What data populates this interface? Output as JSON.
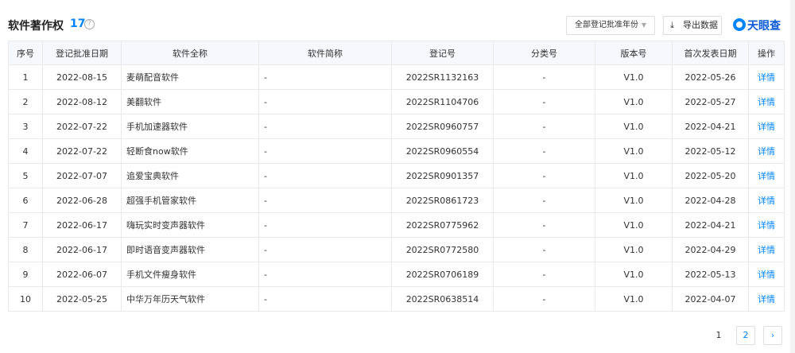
{
  "header": {
    "title": "软件著作权",
    "count": "17",
    "help_icon": "?",
    "year_select": "全部登记批准年份",
    "export_label": "导出数据",
    "logo_text": "天眼查"
  },
  "table": {
    "columns": [
      "序号",
      "登记批准日期",
      "软件全称",
      "软件简称",
      "登记号",
      "分类号",
      "版本号",
      "首次发表日期",
      "操作"
    ],
    "rows": [
      {
        "no": "1",
        "date": "2022-08-15",
        "name": "麦萌配音软件",
        "short": "-",
        "reg": "2022SR1132163",
        "cls": "-",
        "ver": "V1.0",
        "pub": "2022-05-26",
        "op": "详情"
      },
      {
        "no": "2",
        "date": "2022-08-12",
        "name": "美翻软件",
        "short": "-",
        "reg": "2022SR1104706",
        "cls": "-",
        "ver": "V1.0",
        "pub": "2022-05-27",
        "op": "详情"
      },
      {
        "no": "3",
        "date": "2022-07-22",
        "name": "手机加速器软件",
        "short": "-",
        "reg": "2022SR0960757",
        "cls": "-",
        "ver": "V1.0",
        "pub": "2022-04-21",
        "op": "详情"
      },
      {
        "no": "4",
        "date": "2022-07-22",
        "name": "轻断食now软件",
        "short": "-",
        "reg": "2022SR0960554",
        "cls": "-",
        "ver": "V1.0",
        "pub": "2022-05-12",
        "op": "详情"
      },
      {
        "no": "5",
        "date": "2022-07-07",
        "name": "追爱宝典软件",
        "short": "-",
        "reg": "2022SR0901357",
        "cls": "-",
        "ver": "V1.0",
        "pub": "2022-05-20",
        "op": "详情"
      },
      {
        "no": "6",
        "date": "2022-06-28",
        "name": "超强手机管家软件",
        "short": "-",
        "reg": "2022SR0861723",
        "cls": "-",
        "ver": "V1.0",
        "pub": "2022-04-28",
        "op": "详情"
      },
      {
        "no": "7",
        "date": "2022-06-17",
        "name": "嗨玩实时变声器软件",
        "short": "-",
        "reg": "2022SR0775962",
        "cls": "-",
        "ver": "V1.0",
        "pub": "2022-04-21",
        "op": "详情"
      },
      {
        "no": "8",
        "date": "2022-06-17",
        "name": "即时语音变声器软件",
        "short": "-",
        "reg": "2022SR0772580",
        "cls": "-",
        "ver": "V1.0",
        "pub": "2022-04-29",
        "op": "详情"
      },
      {
        "no": "9",
        "date": "2022-06-07",
        "name": "手机文件瘦身软件",
        "short": "-",
        "reg": "2022SR0706189",
        "cls": "-",
        "ver": "V1.0",
        "pub": "2022-05-13",
        "op": "详情"
      },
      {
        "no": "10",
        "date": "2022-05-25",
        "name": "中华万年历天气软件",
        "short": "-",
        "reg": "2022SR0638514",
        "cls": "-",
        "ver": "V1.0",
        "pub": "2022-04-07",
        "op": "详情"
      }
    ]
  },
  "pager": {
    "page1": "1",
    "page2": "2",
    "next": "›"
  },
  "colors": {
    "accent": "#0084ff",
    "header_bg": "#f5f8fd",
    "border": "#e8eaed"
  }
}
